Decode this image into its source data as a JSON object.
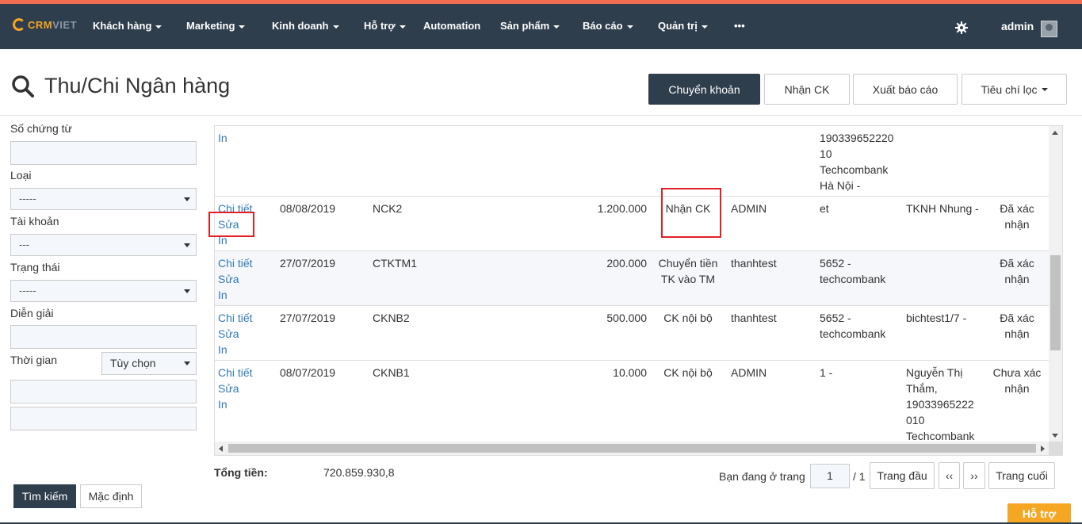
{
  "nav": {
    "logo_main": "CRM",
    "logo_sub": "VIET",
    "items": [
      {
        "label": "Khách hàng",
        "caret": true
      },
      {
        "label": "Marketing",
        "caret": true
      },
      {
        "label": "Kinh doanh",
        "caret": true
      },
      {
        "label": "Hỗ trợ",
        "caret": true
      },
      {
        "label": "Automation",
        "caret": false
      },
      {
        "label": "Sản phẩm",
        "caret": true
      },
      {
        "label": "Báo cáo",
        "caret": true
      },
      {
        "label": "Quản trị",
        "caret": true
      },
      {
        "label": "•••",
        "caret": false
      }
    ],
    "user": "admin"
  },
  "page": {
    "title": "Thu/Chi Ngân hàng",
    "actions": {
      "transfer": "Chuyển khoản",
      "receive": "Nhận CK",
      "export": "Xuất báo cáo",
      "filter": "Tiêu chí lọc"
    }
  },
  "filters": {
    "voucher_no_label": "Số chứng từ",
    "type_label": "Loại",
    "type_value": "-----",
    "account_label": "Tài khoản",
    "account_value": "---",
    "status_label": "Trạng thái",
    "status_value": "-----",
    "description_label": "Diễn giải",
    "time_label": "Thời gian",
    "time_value": "Tùy chọn",
    "search_button": "Tìm kiếm",
    "default_button": "Mặc định"
  },
  "table": {
    "rows": [
      {
        "links": [
          "In"
        ],
        "date": "",
        "code": "",
        "amount": "",
        "type": "",
        "user": "",
        "account": "190339652220\n10\nTechcombank\nHà Nội -",
        "counterpart": "",
        "status": ""
      },
      {
        "links": [
          "Chi tiết",
          "Sửa",
          "In"
        ],
        "date": "08/08/2019",
        "code": "NCK2",
        "amount": "1.200.000",
        "type": "Nhận CK",
        "user": "ADMIN",
        "account": "et",
        "counterpart": "TKNH Nhung -",
        "status": "Đã xác\nnhận"
      },
      {
        "links": [
          "Chi tiết",
          "Sửa",
          "In"
        ],
        "date": "27/07/2019",
        "code": "CTKTM1",
        "amount": "200.000",
        "type": "Chuyển tiền\nTK vào TM",
        "user": "thanhtest",
        "account": "5652 -\ntechcombank",
        "counterpart": "",
        "status": "Đã xác\nnhận"
      },
      {
        "links": [
          "Chi tiết",
          "Sửa",
          "In"
        ],
        "date": "27/07/2019",
        "code": "CKNB2",
        "amount": "500.000",
        "type": "CK nội bộ",
        "user": "thanhtest",
        "account": "5652 -\ntechcombank",
        "counterpart": "bichtest1/7 -",
        "status": "Đã xác\nnhận"
      },
      {
        "links": [
          "Chi tiết",
          "Sửa",
          "In"
        ],
        "date": "08/07/2019",
        "code": "CKNB1",
        "amount": "10.000",
        "type": "CK nội bộ",
        "user": "ADMIN",
        "account": "1 -",
        "counterpart": "Nguyễn Thị\nThắm,\n19033965222\n010\nTechcombank",
        "status": "Chưa xác\nnhận"
      }
    ]
  },
  "footer": {
    "total_label": "Tổng tiền:",
    "total_value": "720.859.930,8",
    "page_prefix": "Bạn đang ở trang",
    "current_page": "1",
    "page_suffix": "/ 1",
    "first": "Trang đầu",
    "prev": "‹‹",
    "next": "››",
    "last": "Trang cuối"
  },
  "support": "Hỗ trợ"
}
